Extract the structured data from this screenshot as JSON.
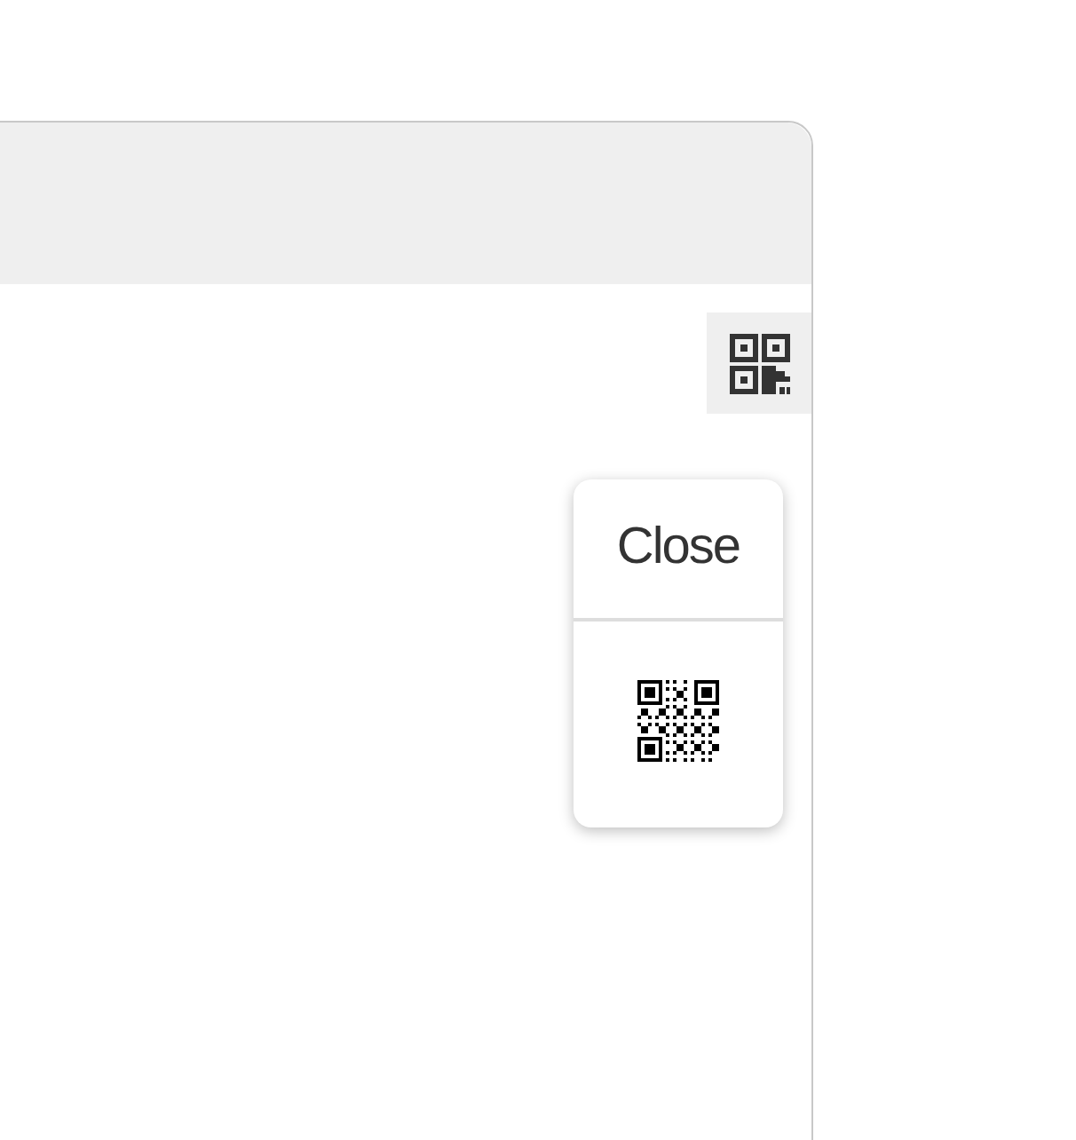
{
  "popup": {
    "close_label": "Close"
  }
}
